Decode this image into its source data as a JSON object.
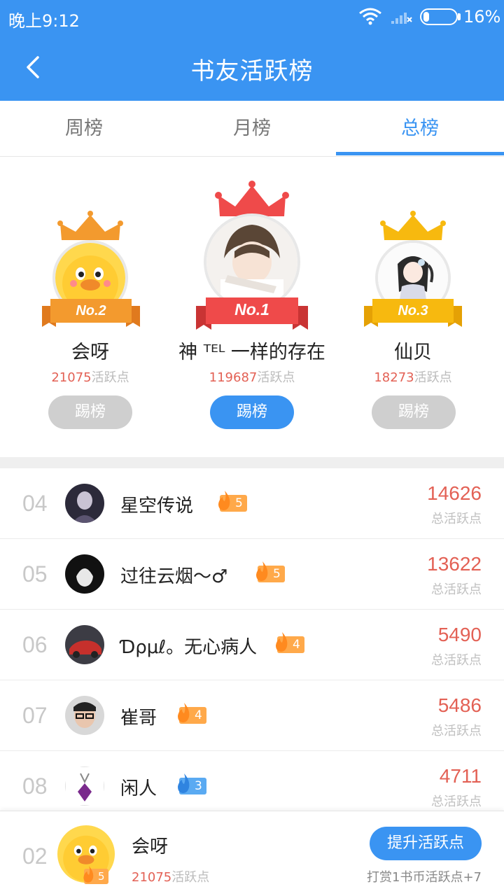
{
  "status": {
    "time": "晚上9:12",
    "battery": "16%"
  },
  "header": {
    "title": "书友活跃榜"
  },
  "tabs": [
    {
      "label": "周榜",
      "active": false
    },
    {
      "label": "月榜",
      "active": false
    },
    {
      "label": "总榜",
      "active": true
    }
  ],
  "podium": {
    "first": {
      "tag": "No.1",
      "name": "神 ᵀᴱᴸ 一样的存在",
      "points": "119687",
      "points_suffix": "活跃点",
      "button": "踢榜"
    },
    "second": {
      "tag": "No.2",
      "name": "会呀",
      "points": "21075",
      "points_suffix": "活跃点",
      "button": "踢榜"
    },
    "third": {
      "tag": "No.3",
      "name": "仙贝",
      "points": "18273",
      "points_suffix": "活跃点",
      "button": "踢榜"
    }
  },
  "list": {
    "score_label": "总活跃点",
    "rows": [
      {
        "rank": "04",
        "name": "星空传说",
        "level": "5",
        "badge_color": "orange",
        "score": "14626"
      },
      {
        "rank": "05",
        "name": "过往云烟～♂",
        "level": "5",
        "badge_color": "orange",
        "score": "13622"
      },
      {
        "rank": "06",
        "name": "Ɗρμℓ。无心病人",
        "level": "4",
        "badge_color": "orange",
        "score": "5490"
      },
      {
        "rank": "07",
        "name": "崔哥",
        "level": "4",
        "badge_color": "orange",
        "score": "5486"
      },
      {
        "rank": "08",
        "name": "闲人",
        "level": "3",
        "badge_color": "blue",
        "score": "4711"
      }
    ]
  },
  "me": {
    "rank": "02",
    "name": "会呀",
    "level": "5",
    "points": "21075",
    "points_suffix": "活跃点",
    "boost_button": "提升活跃点",
    "hint": "打赏1书币活跃点+7"
  },
  "colors": {
    "primary": "#3a94f2",
    "score_red": "#e36155",
    "badge_orange": "#ffa94a",
    "badge_blue": "#5aaaf2"
  }
}
